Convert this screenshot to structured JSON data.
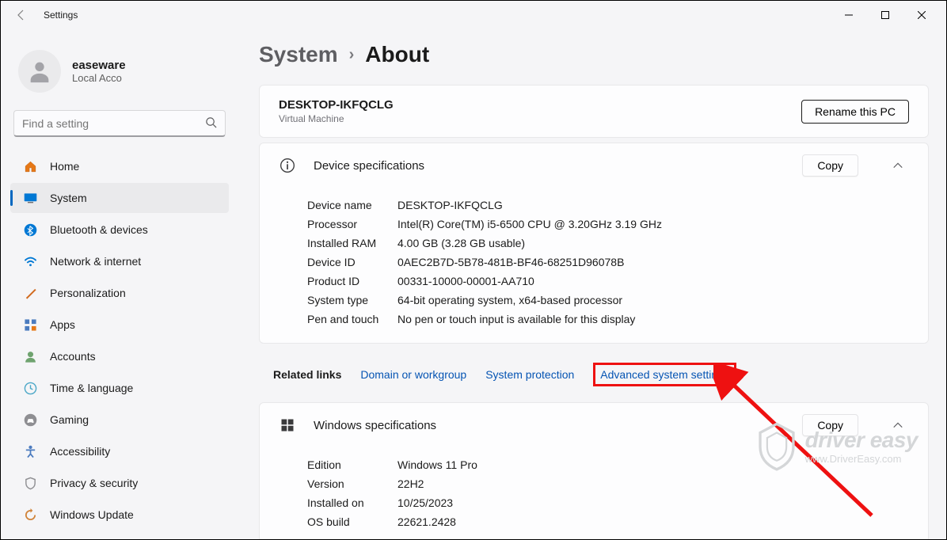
{
  "titlebar": {
    "title": "Settings"
  },
  "account": {
    "username": "easeware",
    "type": "Local Acco"
  },
  "search": {
    "placeholder": "Find a setting"
  },
  "nav": {
    "items": [
      {
        "label": "Home"
      },
      {
        "label": "System"
      },
      {
        "label": "Bluetooth & devices"
      },
      {
        "label": "Network & internet"
      },
      {
        "label": "Personalization"
      },
      {
        "label": "Apps"
      },
      {
        "label": "Accounts"
      },
      {
        "label": "Time & language"
      },
      {
        "label": "Gaming"
      },
      {
        "label": "Accessibility"
      },
      {
        "label": "Privacy & security"
      },
      {
        "label": "Windows Update"
      }
    ]
  },
  "breadcrumb": {
    "p1": "System",
    "p2": "About"
  },
  "device": {
    "name": "DESKTOP-IKFQCLG",
    "type": "Virtual Machine",
    "rename_label": "Rename this PC"
  },
  "section_device_specs": {
    "title": "Device specifications",
    "copy_label": "Copy",
    "rows": [
      {
        "k": "Device name",
        "v": "DESKTOP-IKFQCLG"
      },
      {
        "k": "Processor",
        "v": "Intel(R) Core(TM) i5-6500 CPU @ 3.20GHz   3.19 GHz"
      },
      {
        "k": "Installed RAM",
        "v": "4.00 GB (3.28 GB usable)"
      },
      {
        "k": "Device ID",
        "v": "0AEC2B7D-5B78-481B-BF46-68251D96078B"
      },
      {
        "k": "Product ID",
        "v": "00331-10000-00001-AA710"
      },
      {
        "k": "System type",
        "v": "64-bit operating system, x64-based processor"
      },
      {
        "k": "Pen and touch",
        "v": "No pen or touch input is available for this display"
      }
    ]
  },
  "related": {
    "label": "Related links",
    "links": [
      "Domain or workgroup",
      "System protection",
      "Advanced system settings"
    ]
  },
  "section_windows_specs": {
    "title": "Windows specifications",
    "copy_label": "Copy",
    "rows": [
      {
        "k": "Edition",
        "v": "Windows 11 Pro"
      },
      {
        "k": "Version",
        "v": "22H2"
      },
      {
        "k": "Installed on",
        "v": "10/25/2023"
      },
      {
        "k": "OS build",
        "v": "22621.2428"
      }
    ]
  },
  "watermark": {
    "line1": "driver easy",
    "line2": "www.DriverEasy.com"
  }
}
